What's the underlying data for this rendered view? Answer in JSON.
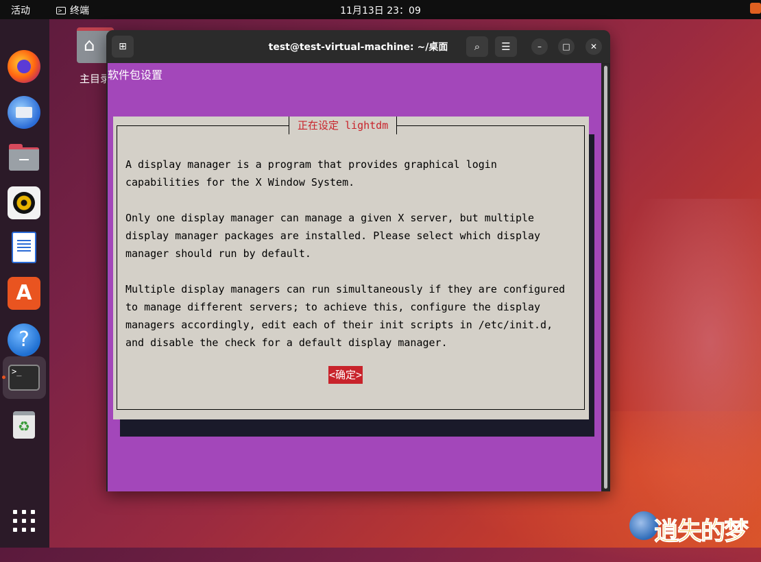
{
  "topbar": {
    "activities": "活动",
    "app_name": "终端",
    "clock": "11月13日 23：09"
  },
  "dock": {
    "items": [
      "firefox-icon",
      "thunderbird-icon",
      "files-icon",
      "rhythmbox-icon",
      "libreoffice-writer-icon",
      "app-store-icon",
      "help-icon",
      "terminal-icon",
      "trash-icon",
      "show-apps-icon"
    ],
    "help_glyph": "?",
    "store_glyph": "A",
    "terminal_glyph": ">_",
    "trash_glyph": "♻"
  },
  "desktop": {
    "home_label": "主目录"
  },
  "window": {
    "title": "test@test-virtual-machine: ~/桌面",
    "newtab_glyph": "⊞",
    "search_glyph": "⌕",
    "menu_glyph": "☰",
    "min_glyph": "–",
    "max_glyph": "□",
    "close_glyph": "✕"
  },
  "terminal": {
    "background_title": "软件包设置",
    "dialog": {
      "title": "正在设定 lightdm",
      "paragraph1": "A display manager is a program that provides graphical login\ncapabilities for the X Window System.",
      "paragraph2": "Only one display manager can manage a given X server, but multiple\ndisplay manager packages are installed. Please select which display\nmanager should run by default.",
      "paragraph3": "Multiple display managers can run simultaneously if they are configured\nto manage different servers; to achieve this, configure the display\nmanagers accordingly, edit each of their init scripts in /etc/init.d,\nand disable the check for a default display manager.",
      "ok_button": "<确定>"
    }
  },
  "watermark": {
    "text": "逍失的梦"
  },
  "colors": {
    "terminal_bg": "#a347ba",
    "dialog_bg": "#d4d0c8",
    "accent_red": "#c8232b",
    "ubuntu_orange": "#e95420"
  }
}
